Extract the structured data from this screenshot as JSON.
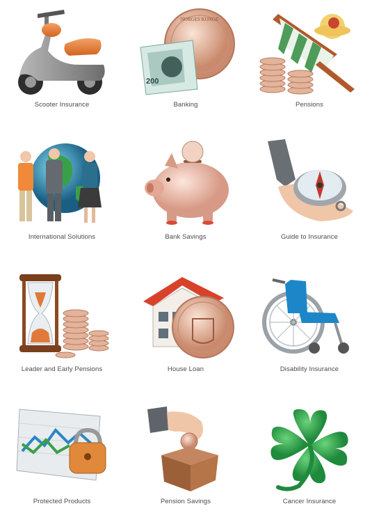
{
  "items": [
    {
      "label": "Scooter Insurance",
      "icon": "scooter-icon"
    },
    {
      "label": "Banking",
      "icon": "banknote-coin-icon"
    },
    {
      "label": "Pensions",
      "icon": "beach-chair-coins-icon"
    },
    {
      "label": "International Solutions",
      "icon": "globe-people-icon"
    },
    {
      "label": "Bank Savings",
      "icon": "piggy-bank-icon"
    },
    {
      "label": "Guide to Insurance",
      "icon": "hand-compass-icon"
    },
    {
      "label": "Leader and Early Pensions",
      "icon": "hourglass-coins-icon"
    },
    {
      "label": "House Loan",
      "icon": "house-coin-icon"
    },
    {
      "label": "Disability Insurance",
      "icon": "wheelchair-icon"
    },
    {
      "label": "Protected Products",
      "icon": "chart-padlock-icon"
    },
    {
      "label": "Pension Savings",
      "icon": "hand-coin-box-icon"
    },
    {
      "label": "Cancer Insurance",
      "icon": "four-leaf-clover-icon"
    }
  ],
  "banknote_value": "200",
  "coin_text": "NORGES KONGE",
  "colors": {
    "label": "#4a4a4a",
    "coin": "#e8b8a0",
    "accent_orange": "#e8742a"
  }
}
